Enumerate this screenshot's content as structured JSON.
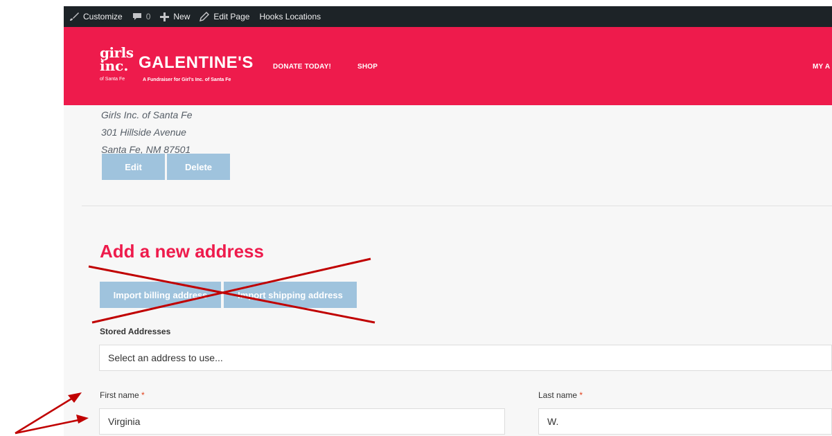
{
  "admin_bar": {
    "customize": "Customize",
    "comments_count": "0",
    "new": "New",
    "edit_page": "Edit Page",
    "hooks": "Hooks Locations"
  },
  "header": {
    "logo_top": "girls",
    "logo_bottom": "inc.",
    "logo_sub": "of Santa Fe",
    "title": "GALENTINE'S",
    "tagline": "A Fundraiser for Girl's Inc. of Santa Fe",
    "nav": {
      "donate": "DONATE TODAY!",
      "shop": "SHOP",
      "account": "MY A"
    }
  },
  "address": {
    "line1": "Girls Inc. of Santa Fe",
    "line2": "301 Hillside Avenue",
    "line3": "Santa Fe, NM 87501",
    "edit_label": "Edit",
    "delete_label": "Delete"
  },
  "new_address": {
    "heading": "Add a new address",
    "import_billing": "Import billing address",
    "import_shipping": "Import shipping address",
    "stored_label": "Stored Addresses",
    "stored_placeholder": "Select an address to use...",
    "first_label": "First name",
    "last_label": "Last name",
    "required_mark": "*",
    "first_value": "Virginia",
    "last_value": "W."
  },
  "colors": {
    "brand": "#ee1b4c",
    "admin_bar": "#1d2327",
    "button": "#9fc3dd",
    "annotation": "#c00000"
  },
  "icons": [
    "paintbrush-icon",
    "comment-icon",
    "plus-icon",
    "pencil-icon"
  ]
}
